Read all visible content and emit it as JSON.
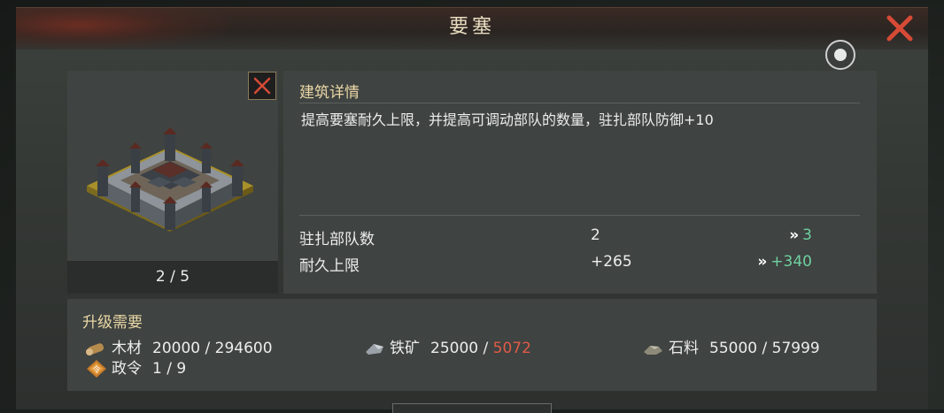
{
  "header": {
    "title": "要塞"
  },
  "image_panel": {
    "level_text": "2 / 5"
  },
  "details": {
    "heading": "建筑详情",
    "description": "提高要塞耐久上限，并提高可调动部队的数量，驻扎部队防御+10",
    "stats": [
      {
        "label": "驻扎部队数",
        "current": "2",
        "next": "3"
      },
      {
        "label": "耐久上限",
        "current": "+265",
        "next": "+340"
      }
    ],
    "arrow": "»"
  },
  "requirements": {
    "heading": "升级需要",
    "wood": {
      "label": "木材",
      "need": "20000",
      "have": "294600"
    },
    "iron": {
      "label": "铁矿",
      "need": "25000",
      "have": "5072"
    },
    "stone": {
      "label": "石料",
      "need": "55000",
      "have": "57999"
    },
    "order": {
      "label": "政令",
      "need": "1",
      "have": "9"
    }
  },
  "colors": {
    "accent_gold": "#ead7a6",
    "next_value_green": "#6fd0a0",
    "insufficient_red": "#e05a48",
    "close_red": "#d64a36"
  }
}
